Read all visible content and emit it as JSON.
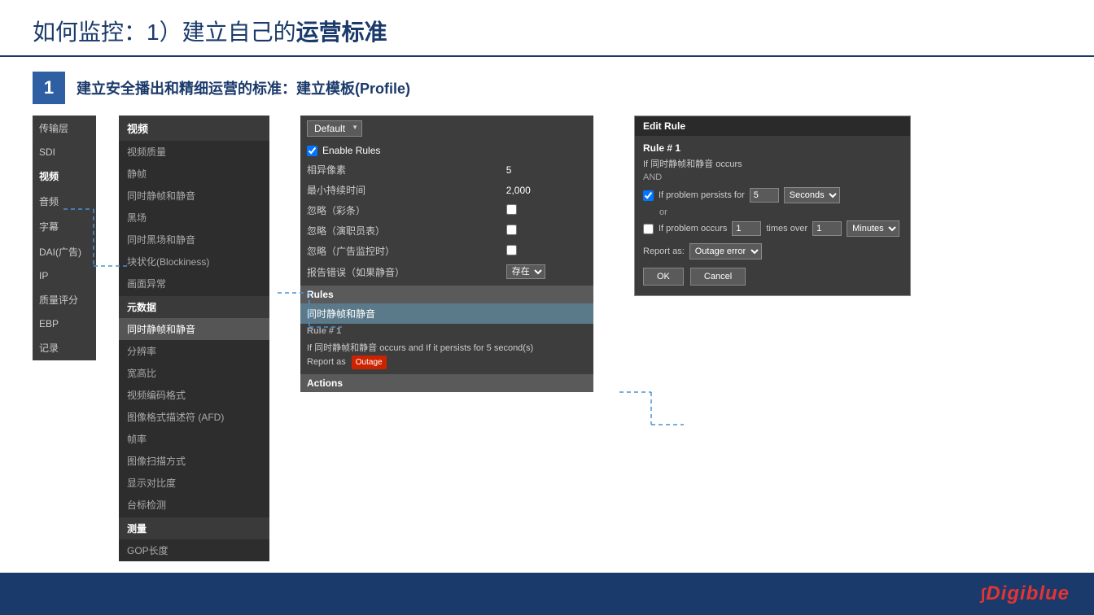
{
  "header": {
    "title_prefix": "如何监控：1）建立自己的",
    "title_bold": "运营标准"
  },
  "section": {
    "number": "1",
    "title": "建立安全播出和精细运营的标准：建立模板(Profile)"
  },
  "sidebar_left": {
    "items": [
      {
        "label": "传输层",
        "active": false
      },
      {
        "label": "SDI",
        "active": false
      },
      {
        "label": "视频",
        "active": true
      },
      {
        "label": "音频",
        "active": false
      },
      {
        "label": "字幕",
        "active": false
      },
      {
        "label": "DAI(广告)",
        "active": false
      },
      {
        "label": "IP",
        "active": false
      },
      {
        "label": "质量评分",
        "active": false
      },
      {
        "label": "EBP",
        "active": false
      },
      {
        "label": "记录",
        "active": false
      }
    ]
  },
  "panel_middle": {
    "section1_label": "视频",
    "items1": [
      {
        "label": "视频质量",
        "active": false
      },
      {
        "label": "静帧",
        "active": false
      },
      {
        "label": "同时静帧和静音",
        "active": false
      },
      {
        "label": "黑场",
        "active": false
      },
      {
        "label": "同时黑场和静音",
        "active": false
      },
      {
        "label": "块状化(Blockiness)",
        "active": false
      },
      {
        "label": "画面异常",
        "active": false
      }
    ],
    "section2_label": "元数据",
    "items2": [
      {
        "label": "同时静帧和静音",
        "active": true
      },
      {
        "label": "分辨率",
        "active": false
      },
      {
        "label": "宽高比",
        "active": false
      },
      {
        "label": "视频编码格式",
        "active": false
      },
      {
        "label": "图像格式描述符 (AFD)",
        "active": false
      },
      {
        "label": "帧率",
        "active": false
      },
      {
        "label": "图像扫描方式",
        "active": false
      },
      {
        "label": "显示对比度",
        "active": false
      },
      {
        "label": "台标检测",
        "active": false
      }
    ],
    "section3_label": "测量",
    "items3": [
      {
        "label": "GOP长度",
        "active": false
      }
    ]
  },
  "center_panel": {
    "dropdown_label": "Default",
    "enable_rules_label": "Enable Rules",
    "settings": [
      {
        "label": "相异像素",
        "value": "5"
      },
      {
        "label": "最小持续时间",
        "value": "2,000"
      },
      {
        "label": "忽略（彩条）",
        "value": "checkbox"
      },
      {
        "label": "忽略（演职员表）",
        "value": "checkbox"
      },
      {
        "label": "忽略（广告监控时）",
        "value": "checkbox"
      },
      {
        "label": "报告错误（如果静音）",
        "value": "存在",
        "type": "select"
      }
    ],
    "rules_label": "Rules",
    "rule_highlighted": "同时静帧和静音",
    "rule1_label": "Rule # 1",
    "rule1_desc1": "If 同时静帧和静音 occurs  and If it persists for 5 second(s)",
    "rule1_desc2": "Report as",
    "outage_badge": "Outage",
    "actions_label": "Actions"
  },
  "edit_rule_dialog": {
    "title": "Edit Rule",
    "rule_num": "Rule # 1",
    "condition1": "If 同时静帧和静音 occurs",
    "condition_and": "AND",
    "checkbox1_label": "If problem persists for",
    "persists_value": "5",
    "seconds_label": "Seconds",
    "or_label": "or",
    "checkbox2_label": "If problem occurs",
    "occurs_value": "1",
    "times_over_label": "times over",
    "over_value": "1",
    "minutes_label": "Minutes",
    "report_label": "Report as:",
    "report_value": "Outage error",
    "ok_label": "OK",
    "cancel_label": "Cancel"
  },
  "footer": {
    "logo_prefix": "",
    "logo_brand": "Digiblue"
  }
}
